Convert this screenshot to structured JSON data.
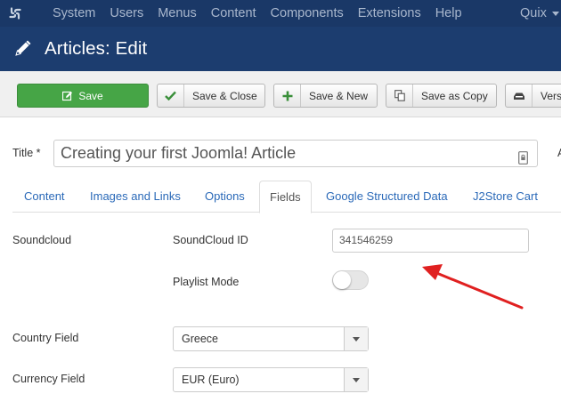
{
  "menubar": {
    "items": [
      "System",
      "Users",
      "Menus",
      "Content",
      "Components",
      "Extensions",
      "Help"
    ],
    "site_menu": "Quix"
  },
  "page": {
    "title": "Articles: Edit"
  },
  "toolbar": {
    "save": "Save",
    "save_close": "Save & Close",
    "save_new": "Save & New",
    "save_copy": "Save as Copy",
    "versions": "Versi"
  },
  "form": {
    "title_label": "Title *",
    "title_value": "Creating your first Joomla! Article",
    "alias_label_cut": "A"
  },
  "tabs": [
    "Content",
    "Images and Links",
    "Options",
    "Fields",
    "Google Structured Data",
    "J2Store Cart"
  ],
  "active_tab": "Fields",
  "fields": {
    "group_label": "Soundcloud",
    "soundcloud_id_label": "SoundCloud ID",
    "soundcloud_id_value": "341546259",
    "playlist_label": "Playlist Mode",
    "playlist_enabled": false,
    "country_label": "Country Field",
    "country_value": "Greece",
    "currency_label": "Currency Field",
    "currency_value": "EUR (Euro)"
  },
  "colors": {
    "menubar": "#1a3867",
    "titlebar": "#1c3d6f",
    "save_green": "#46a546",
    "link_blue": "#2a69b8",
    "annotation_red": "#e02020"
  }
}
